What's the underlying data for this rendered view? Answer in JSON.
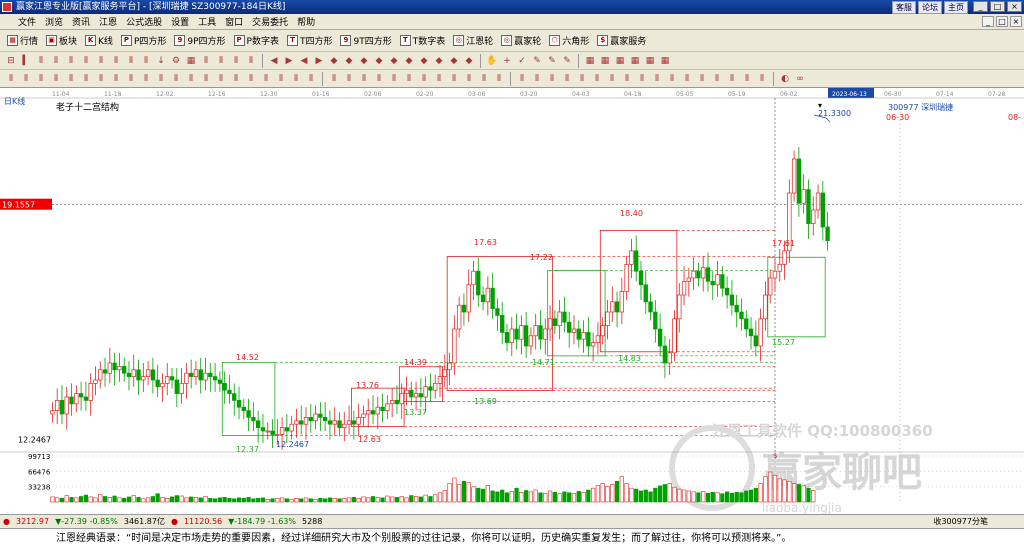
{
  "window": {
    "title": "赢家江恩专业版[赢家服务平台] - [深圳瑞捷   SZ300977-184日K线]",
    "links": [
      "客服",
      "论坛",
      "主页"
    ],
    "win_buttons": [
      "_",
      "□",
      "×"
    ]
  },
  "menu": [
    "文件",
    "浏览",
    "资讯",
    "江恩",
    "公式选股",
    "设置",
    "工具",
    "窗口",
    "交易委托",
    "帮助"
  ],
  "toolbar1": [
    {
      "icon": "▦",
      "label": "行情"
    },
    {
      "icon": "▣",
      "label": "板块"
    },
    {
      "icon": "K",
      "label": "K线"
    },
    {
      "icon": "P",
      "label": "P四方形"
    },
    {
      "icon": "9",
      "label": "9P四方形"
    },
    {
      "icon": "P",
      "label": "P数字表"
    },
    {
      "icon": "T",
      "label": "T四方形"
    },
    {
      "icon": "9",
      "label": "9T四方形"
    },
    {
      "icon": "T",
      "label": "T数字表"
    },
    {
      "icon": "◎",
      "label": "江恩轮"
    },
    {
      "icon": "◎",
      "label": "赢家轮"
    },
    {
      "icon": "⬡",
      "label": "六角形"
    },
    {
      "icon": "$",
      "label": "赢家服务"
    }
  ],
  "toolbar2_icons": [
    "⊟",
    "▍",
    "⫴",
    "⫴",
    "⫴",
    "⫴",
    "⫴",
    "⫴",
    "⫴",
    "⫴",
    "↓",
    "⚙",
    "▦",
    "⫴",
    "⫴",
    "⫴",
    "⫴",
    "|",
    "◀",
    "▶",
    "◀",
    "▶",
    "◆",
    "◆",
    "◆",
    "◆",
    "◆",
    "◆",
    "◆",
    "◆",
    "◆",
    "◆",
    "|",
    "✋",
    "+",
    "✓",
    "✎",
    "✎",
    "✎",
    "|",
    "▦",
    "▦",
    "▦",
    "▦",
    "▦",
    "▦"
  ],
  "toolbar3_icons": [
    "⫴",
    "⫴",
    "⫴",
    "⫴",
    "⫴",
    "⫴",
    "⫴",
    "⫴",
    "⫴",
    "⫴",
    "⫴",
    "⫴",
    "⫴",
    "⫴",
    "⫴",
    "⫴",
    "⫴",
    "⫴",
    "⫴",
    "⫴",
    "⫴",
    "|",
    "⫴",
    "⫴",
    "⫴",
    "⫴",
    "⫴",
    "⫴",
    "⫴",
    "⫴",
    "⫴",
    "⫴",
    "⫴",
    "⫴",
    "|",
    "⫴",
    "⫴",
    "⫴",
    "⫴",
    "⫴",
    "⫴",
    "⫴",
    "⫴",
    "⫴",
    "⫴",
    "⫴",
    "⫴",
    "⫴",
    "⫴",
    "⫴",
    "⫴",
    "⫴",
    "|",
    "◐",
    "∞"
  ],
  "chart_data": {
    "type": "candlestick",
    "period_label": "日K线",
    "subtitle": "老子十二宫结构",
    "stock": "300977  深圳瑞捷",
    "x_dates": [
      "11-04",
      "11-18",
      "12-02",
      "12-16",
      "12-30",
      "01-16",
      "02-06",
      "02-20",
      "03-06",
      "03-20",
      "04-03",
      "04-18",
      "05-05",
      "05-19",
      "06-02",
      "2023-06-13",
      "06-30",
      "07-14",
      "07-28"
    ],
    "highlight_date": "2023-06-13",
    "y_range": [
      12.0,
      22.0
    ],
    "cursor_price": "19.1557",
    "low_marker": "12.2467",
    "price_labels": [
      "21.3300",
      "17.63",
      "17.22",
      "18.40",
      "17.61",
      "14.52",
      "14.39",
      "13.76",
      "14.71",
      "14.83",
      "15.27",
      "13.69",
      "13.37",
      "12.63",
      "12.37",
      "12.2467",
      "06-30",
      "08-"
    ],
    "boxes_red": [
      {
        "name": "box-a",
        "d0": 83,
        "d1": 104,
        "hi": 17.63,
        "lo": 13.69
      },
      {
        "name": "box-b",
        "d0": 115,
        "d1": 130,
        "hi": 18.4,
        "lo": 14.83
      },
      {
        "name": "box-c",
        "d0": 63,
        "d1": 73,
        "hi": 13.76,
        "lo": 12.63
      },
      {
        "name": "box-d",
        "d0": 73,
        "d1": 81,
        "hi": 14.39,
        "lo": 13.37
      }
    ],
    "boxes_green": [
      {
        "name": "box-e",
        "d0": 36,
        "d1": 46,
        "hi": 14.52,
        "lo": 12.37
      },
      {
        "name": "box-f",
        "d0": 104,
        "d1": 115,
        "hi": 17.22,
        "lo": 14.71
      },
      {
        "name": "box-g",
        "d0": 150,
        "d1": 161,
        "hi": 17.61,
        "lo": 15.27
      }
    ],
    "closes": [
      13.1,
      13.4,
      13.0,
      13.5,
      13.3,
      13.6,
      13.5,
      13.4,
      13.9,
      14.0,
      14.3,
      14.2,
      14.5,
      14.3,
      14.4,
      14.2,
      14.1,
      14.3,
      14.0,
      14.1,
      14.3,
      14.0,
      13.8,
      13.9,
      14.1,
      14.0,
      13.6,
      13.9,
      14.2,
      14.1,
      14.3,
      14.0,
      14.2,
      14.1,
      14.0,
      13.9,
      13.7,
      13.6,
      13.4,
      13.2,
      13.1,
      12.9,
      12.8,
      12.6,
      12.5,
      12.5,
      12.4,
      12.4,
      12.6,
      12.5,
      12.7,
      12.8,
      12.7,
      12.9,
      12.8,
      13.0,
      12.9,
      12.8,
      12.7,
      12.8,
      12.6,
      12.7,
      12.8,
      12.7,
      12.9,
      13.0,
      13.1,
      13.0,
      13.2,
      13.1,
      13.3,
      13.4,
      13.3,
      13.6,
      13.7,
      13.5,
      13.6,
      13.5,
      13.8,
      13.7,
      13.9,
      14.1,
      14.3,
      14.5,
      15.5,
      16.2,
      16.0,
      16.8,
      17.2,
      16.5,
      16.3,
      16.7,
      16.1,
      15.9,
      15.4,
      15.1,
      15.5,
      15.2,
      15.6,
      15.0,
      15.3,
      15.6,
      15.2,
      15.5,
      15.8,
      15.6,
      16.0,
      15.7,
      15.4,
      15.5,
      15.2,
      15.4,
      15.0,
      15.1,
      15.3,
      15.6,
      16.0,
      16.3,
      16.0,
      16.6,
      17.4,
      17.8,
      17.2,
      16.8,
      16.3,
      16.0,
      15.5,
      15.0,
      14.5,
      14.8,
      15.8,
      16.5,
      16.9,
      17.0,
      17.2,
      17.0,
      17.3,
      16.9,
      16.8,
      17.1,
      16.7,
      16.5,
      16.2,
      16.0,
      15.8,
      15.5,
      15.3,
      15.0,
      15.8,
      16.5,
      17.0,
      17.2,
      17.4,
      17.8,
      19.5,
      20.5,
      19.2,
      19.6,
      18.6,
      19.0,
      19.5,
      18.5,
      18.1
    ],
    "volumes": [
      11000,
      9000,
      8000,
      14000,
      10000,
      9000,
      12000,
      15000,
      11000,
      9000,
      16000,
      12000,
      10000,
      13000,
      9000,
      8000,
      11000,
      14000,
      10000,
      7000,
      9000,
      12000,
      18000,
      10000,
      8000,
      11000,
      14000,
      13000,
      9000,
      11000,
      10000,
      9000,
      12000,
      8000,
      7000,
      9000,
      10000,
      8000,
      7000,
      9000,
      8000,
      10000,
      7000,
      8000,
      9000,
      6000,
      7000,
      8000,
      9000,
      7000,
      6000,
      8000,
      7000,
      9000,
      7000,
      6000,
      8000,
      7000,
      9000,
      8000,
      7000,
      8000,
      9000,
      10000,
      8000,
      11000,
      9000,
      12000,
      10000,
      9000,
      13000,
      11000,
      10000,
      12000,
      9000,
      14000,
      12000,
      11000,
      15000,
      12000,
      16000,
      20000,
      25000,
      40000,
      52000,
      38000,
      45000,
      42000,
      33000,
      30000,
      28000,
      36000,
      24000,
      22000,
      26000,
      20000,
      23000,
      30000,
      21000,
      25000,
      22000,
      26000,
      20000,
      19000,
      24000,
      21000,
      18000,
      22000,
      20000,
      19000,
      23000,
      21000,
      26000,
      30000,
      36000,
      40000,
      34000,
      38000,
      45000,
      55000,
      40000,
      30000,
      28000,
      24000,
      26000,
      22000,
      30000,
      35000,
      38000,
      40000,
      32000,
      28000,
      26000,
      24000,
      22000,
      20000,
      23000,
      19000,
      21000,
      20000,
      18000,
      22000,
      19000,
      21000,
      20000,
      24000,
      26000,
      30000,
      40000,
      55000,
      65000,
      58000,
      50000,
      48000,
      45000,
      40000,
      38000,
      35000,
      30000,
      25000
    ],
    "volume_axis": [
      "99713",
      "66476",
      "33238"
    ],
    "volume_ylim": [
      0,
      99713
    ]
  },
  "watermark": {
    "line1": "江恩工具软件  QQ:100800360",
    "line2": "赢家聊吧",
    "line3": "liaoba.yingjia"
  },
  "status": {
    "sh_index": "3212.97",
    "sh_change": "▼-27.39 -0.85%",
    "sh_amount": "3461.87亿",
    "sz_index": "11120.56",
    "sz_change": "▼-184.79 -1.63%",
    "sz_amount": "5288",
    "right_label": "收300977分笔"
  },
  "quote": "江恩经典语录：“时间是决定市场走势的重要因素，经过详细研究大市及个别股票的过往记录，你将可以证明，历史确实重复发生；而了解过往，你将可以预测将来。”。"
}
